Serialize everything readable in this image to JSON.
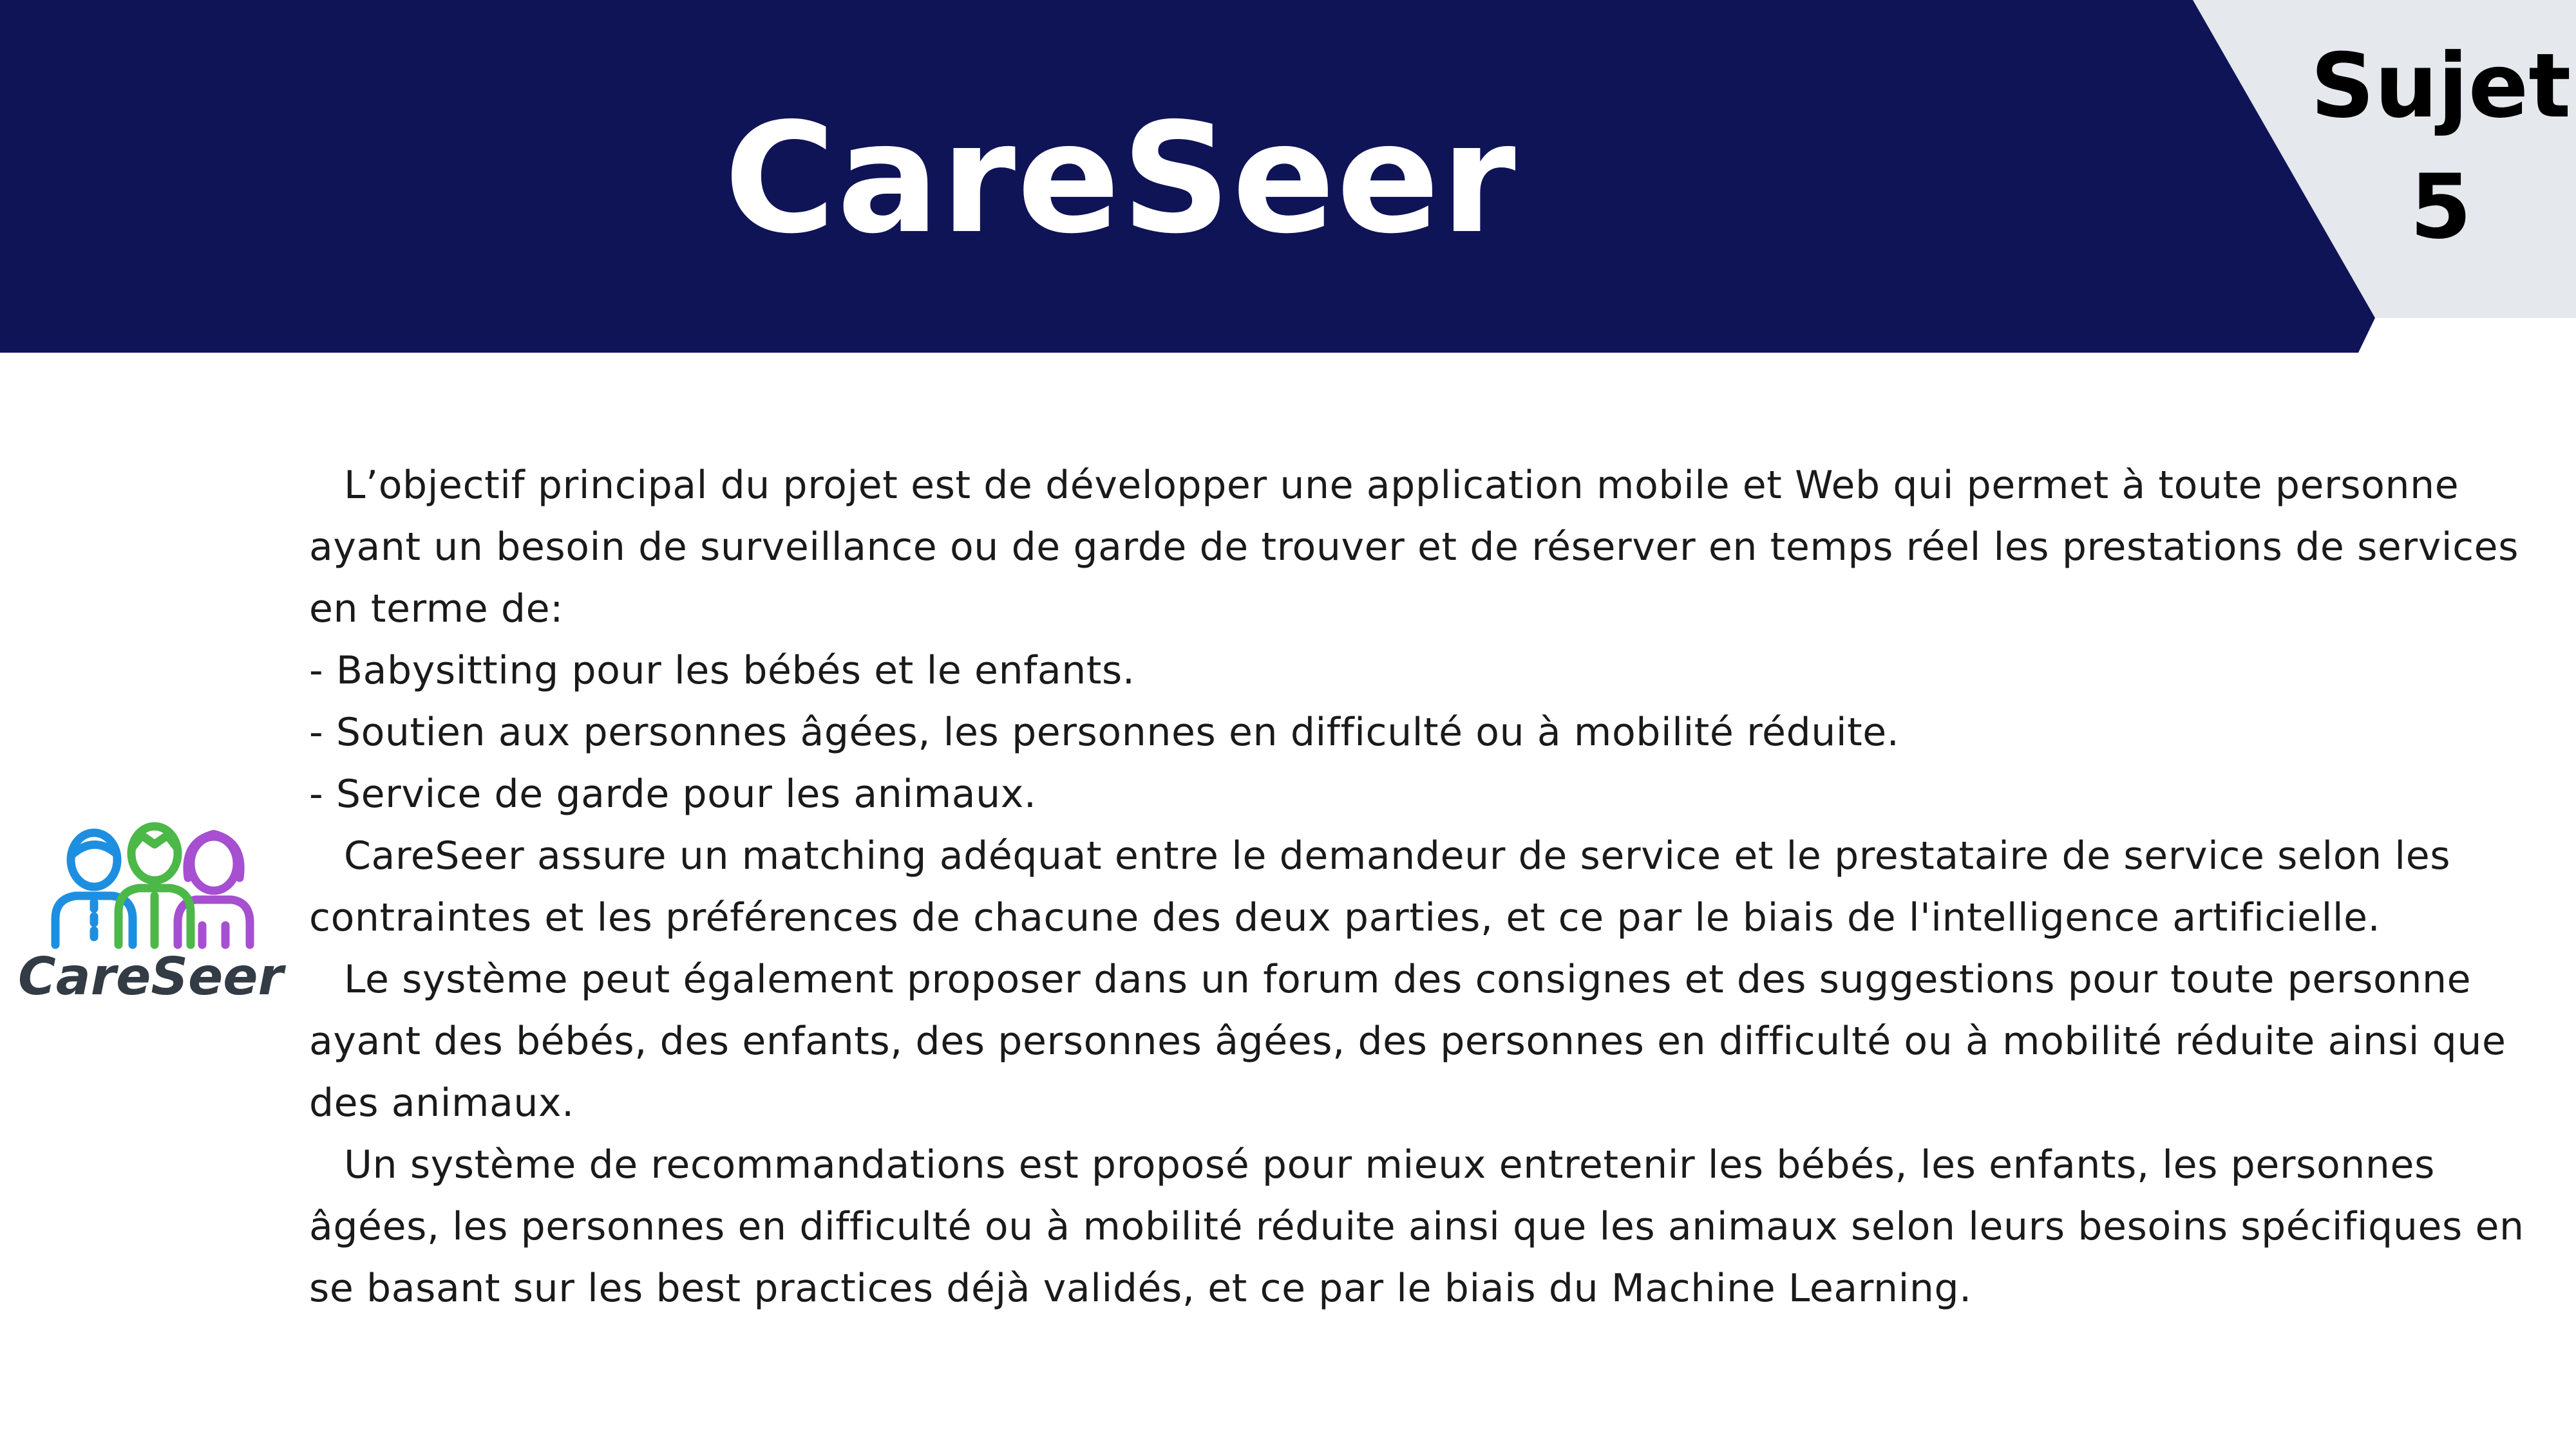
{
  "header": {
    "title": "CareSeer",
    "band_color": "#0f1457",
    "tag_line1": "Sujet",
    "tag_line2": "5",
    "tag_color": "#e5e8ec"
  },
  "logo": {
    "text": "CareSeer",
    "icon": "three-people-icon"
  },
  "body": {
    "paragraph1": "L’objectif principal du projet est de développer une application mobile et Web qui permet à toute personne ayant un besoin de surveillance ou de garde de trouver et de réserver en temps réel les prestations de services en terme de:",
    "bullet1": "- Babysitting pour les bébés et le enfants.",
    "bullet2": "- Soutien aux personnes âgées, les personnes en difficulté ou à mobilité réduite.",
    "bullet3": "- Service de garde pour les animaux.",
    "paragraph2": "CareSeer assure un matching adéquat entre le demandeur de service et le prestataire de service selon les contraintes et les préférences de chacune des deux parties, et ce par le biais de l'intelligence artificielle.",
    "paragraph3": "Le système peut également proposer dans un forum des consignes et des suggestions pour toute personne ayant des bébés, des enfants, des personnes âgées, des personnes en difficulté ou à mobilité réduite ainsi que des animaux.",
    "paragraph4": "Un système de recommandations est proposé pour mieux entretenir les bébés, les enfants, les personnes âgées, les personnes en difficulté ou à mobilité réduite ainsi que les animaux selon leurs besoins spécifiques en se basant sur les best practices déjà validés, et ce par le biais du Machine Learning."
  }
}
